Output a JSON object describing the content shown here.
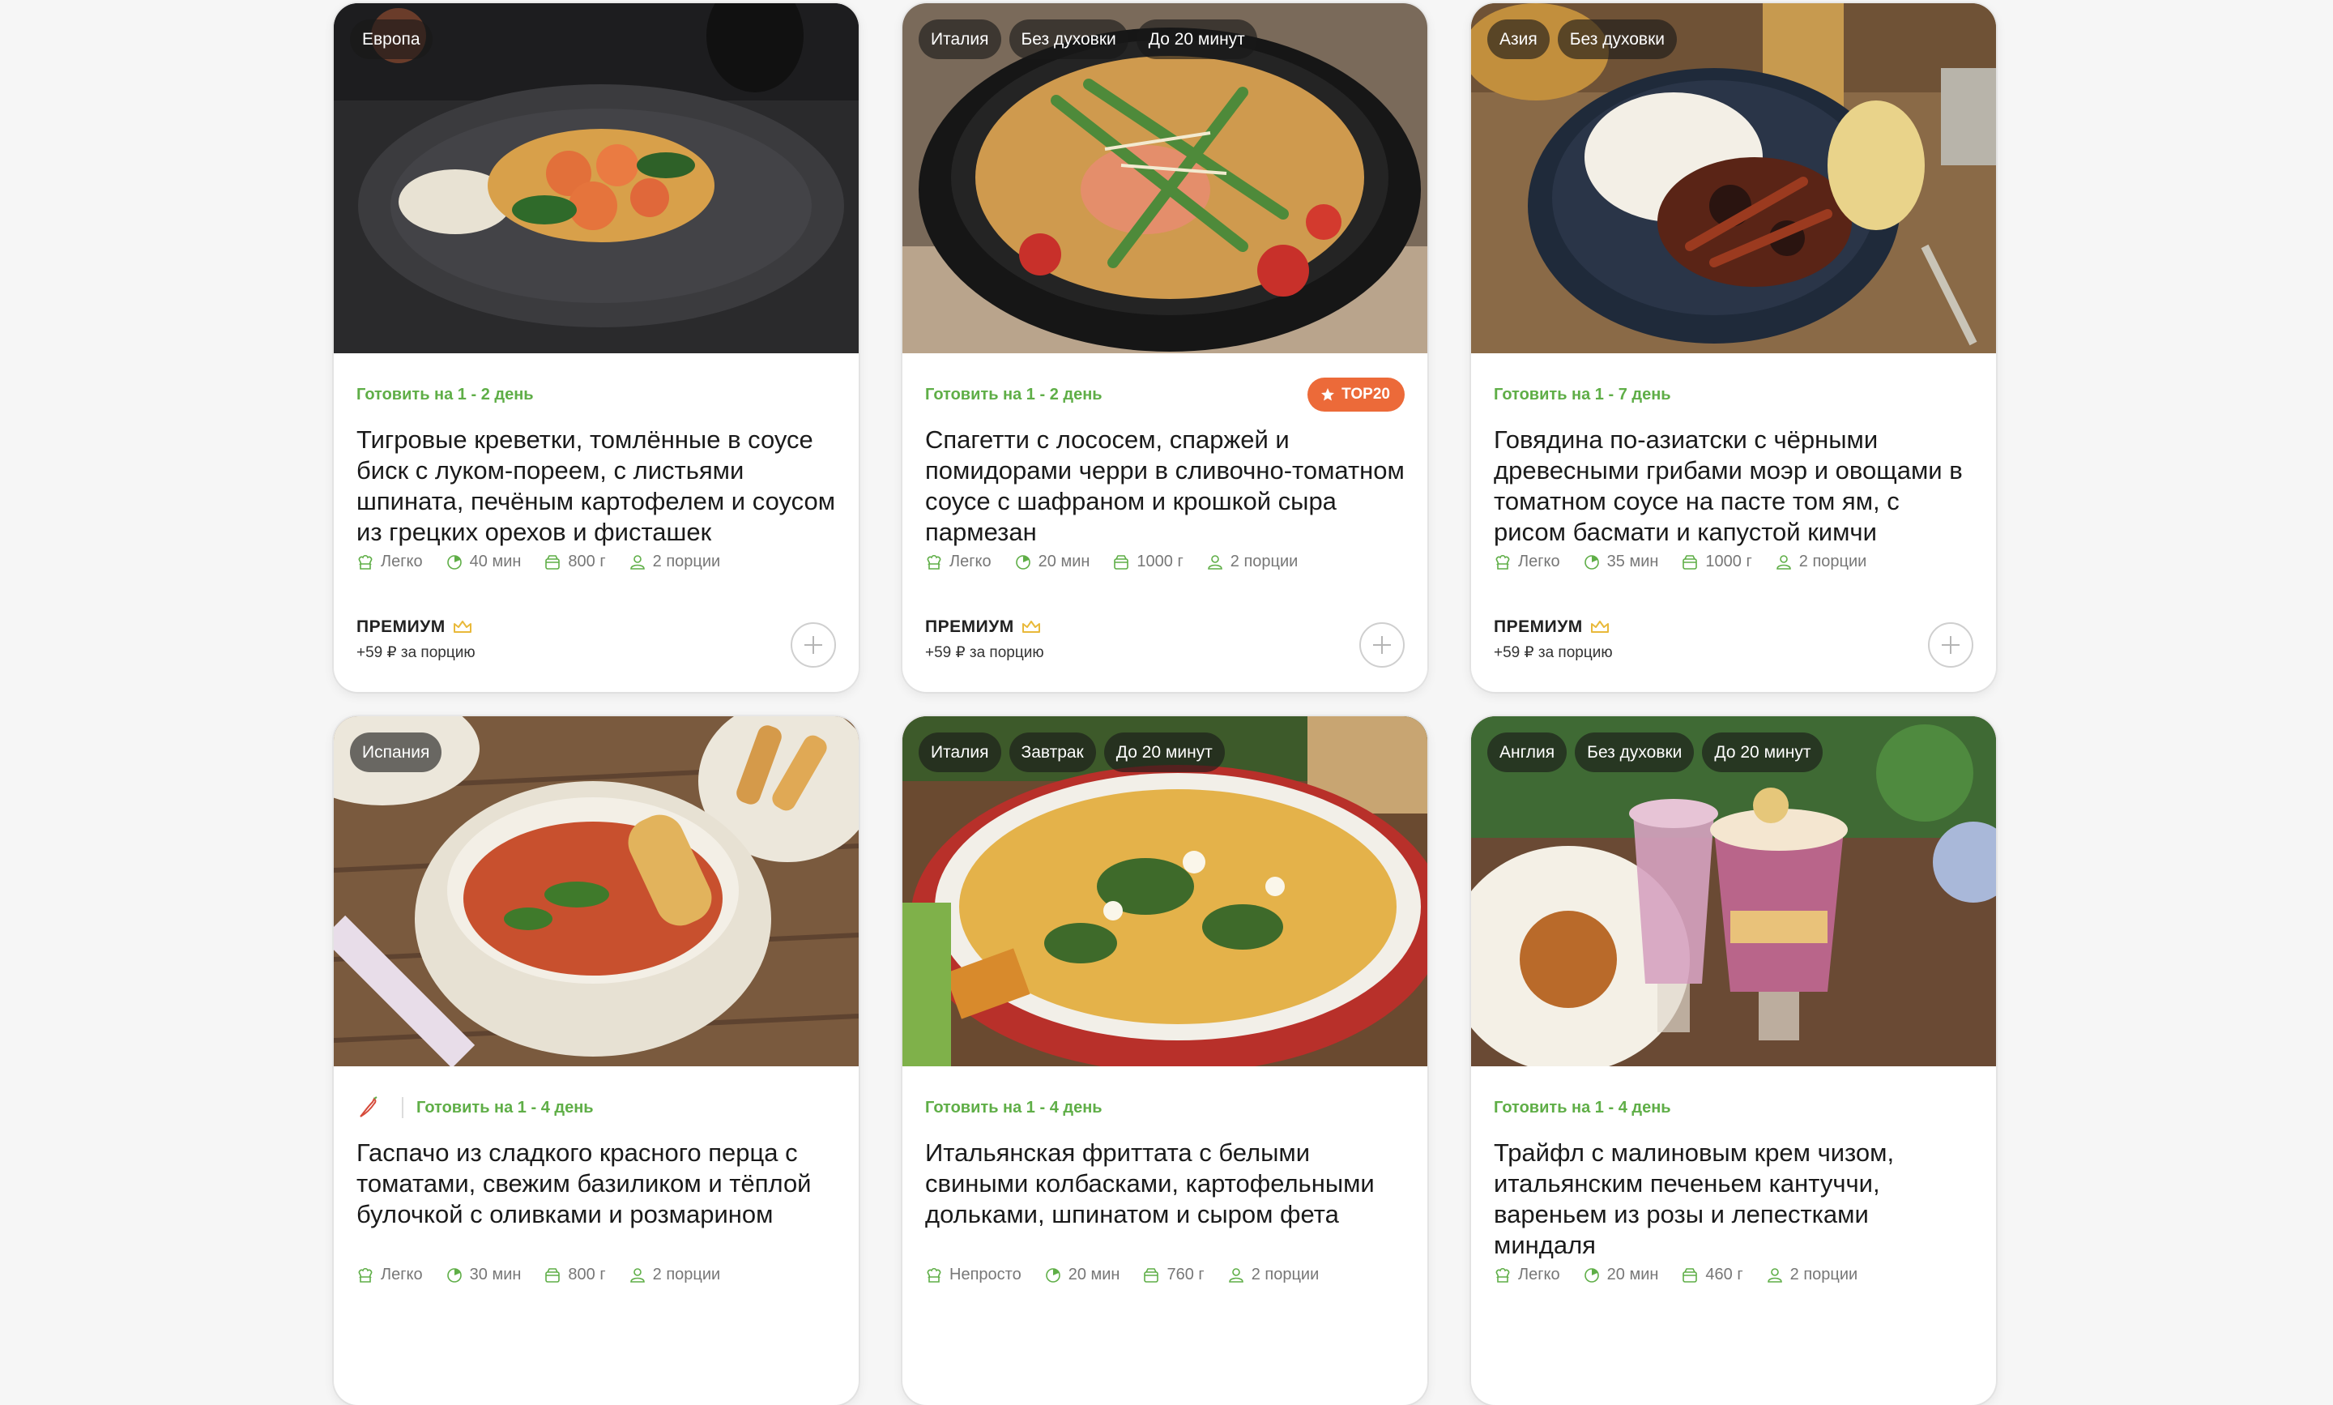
{
  "colors": {
    "accent_green": "#5fae47",
    "top_badge": "#ec6a39",
    "premium_crown": "#e9b93a"
  },
  "cards": [
    {
      "tags": [
        "Европа"
      ],
      "cook": "Готовить на 1 - 2 день",
      "badge": "",
      "title": "Тигровые креветки, томлённые в соусе биск с луком-пореем, с листьями шпината, печёным картофелем и соусом из грецких орехов и фисташек",
      "difficulty": "Легко",
      "time": "40 мин",
      "weight": "800 г",
      "portions": "2 порции",
      "premium": "ПРЕМИУМ",
      "price": "+59 ₽ за порцию"
    },
    {
      "tags": [
        "Италия",
        "Без духовки",
        "До 20 минут"
      ],
      "cook": "Готовить на 1 - 2 день",
      "badge": "TOP20",
      "title": "Спагетти с лососем, спаржей и помидорами черри в сливочно-томатном соусе с шафраном и крошкой сыра пармезан",
      "difficulty": "Легко",
      "time": "20 мин",
      "weight": "1000 г",
      "portions": "2 порции",
      "premium": "ПРЕМИУМ",
      "price": "+59 ₽ за порцию"
    },
    {
      "tags": [
        "Азия",
        "Без духовки"
      ],
      "cook": "Готовить на 1 - 7 день",
      "badge": "",
      "title": "Говядина по-азиатски с чёрными древесными грибами моэр и овощами в томатном соусе на пасте том ям, с рисом басмати и капустой кимчи",
      "difficulty": "Легко",
      "time": "35 мин",
      "weight": "1000 г",
      "portions": "2 порции",
      "premium": "ПРЕМИУМ",
      "price": "+59 ₽ за порцию"
    },
    {
      "tags": [
        "Испания"
      ],
      "cook": "Готовить на 1 - 4 день",
      "badge": "",
      "spicy": true,
      "title": "Гаспачо из сладкого красного перца с томатами, свежим базиликом и тёплой булочкой с оливками и розмарином",
      "difficulty": "Легко",
      "time": "30 мин",
      "weight": "800 г",
      "portions": "2 порции"
    },
    {
      "tags": [
        "Италия",
        "Завтрак",
        "До 20 минут"
      ],
      "cook": "Готовить на 1 - 4 день",
      "badge": "",
      "title": "Итальянская фриттата с белыми свиными колбасками, картофельными дольками, шпинатом и сыром фета",
      "difficulty": "Непросто",
      "time": "20 мин",
      "weight": "760 г",
      "portions": "2 порции"
    },
    {
      "tags": [
        "Англия",
        "Без духовки",
        "До 20 минут"
      ],
      "cook": "Готовить на 1 - 4 день",
      "badge": "",
      "title": "Трайфл с малиновым крем чизом, итальянским печеньем кантуччи, вареньем из розы и лепестками миндаля",
      "difficulty": "Легко",
      "time": "20 мин",
      "weight": "460 г",
      "portions": "2 порции"
    }
  ]
}
